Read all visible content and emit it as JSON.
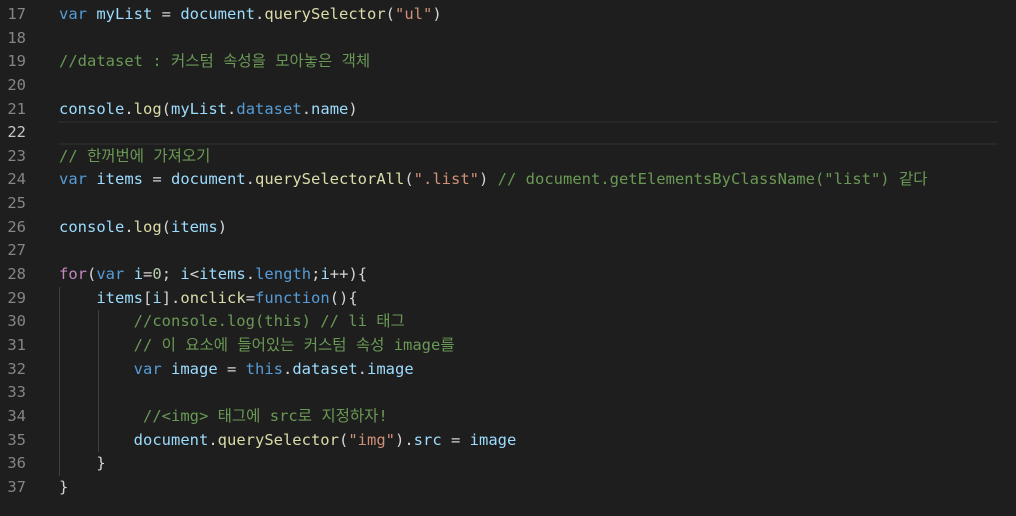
{
  "editor": {
    "theme": {
      "background": "#1e1e1e",
      "keyword": "#569cd6",
      "control": "#c586c0",
      "variable": "#9cdcfe",
      "function": "#dcdcaa",
      "string": "#ce9178",
      "number": "#b5cea8",
      "comment": "#6a9955",
      "plain": "#d4d4d4",
      "line_number": "#858585"
    },
    "current_line": 22,
    "lines": [
      {
        "n": "17",
        "indent": 0,
        "tokens": [
          {
            "t": "kw",
            "v": "var"
          },
          {
            "t": "p",
            "v": " "
          },
          {
            "t": "var",
            "v": "myList"
          },
          {
            "t": "p",
            "v": " = "
          },
          {
            "t": "var",
            "v": "document"
          },
          {
            "t": "p",
            "v": "."
          },
          {
            "t": "fn",
            "v": "querySelector"
          },
          {
            "t": "p",
            "v": "("
          },
          {
            "t": "str",
            "v": "\"ul\""
          },
          {
            "t": "p",
            "v": ")"
          }
        ]
      },
      {
        "n": "18",
        "indent": 0,
        "tokens": []
      },
      {
        "n": "19",
        "indent": 0,
        "tokens": [
          {
            "t": "cm",
            "v": "//dataset : 커스텀 속성을 모아놓은 객체"
          }
        ]
      },
      {
        "n": "20",
        "indent": 0,
        "tokens": []
      },
      {
        "n": "21",
        "indent": 0,
        "tokens": [
          {
            "t": "var",
            "v": "console"
          },
          {
            "t": "p",
            "v": "."
          },
          {
            "t": "fn",
            "v": "log"
          },
          {
            "t": "p",
            "v": "("
          },
          {
            "t": "var",
            "v": "myList"
          },
          {
            "t": "p",
            "v": "."
          },
          {
            "t": "kw",
            "v": "dataset"
          },
          {
            "t": "p",
            "v": "."
          },
          {
            "t": "var",
            "v": "name"
          },
          {
            "t": "p",
            "v": ")"
          }
        ]
      },
      {
        "n": "22",
        "indent": 0,
        "tokens": []
      },
      {
        "n": "23",
        "indent": 0,
        "tokens": [
          {
            "t": "cm",
            "v": "// 한꺼번에 가져오기"
          }
        ]
      },
      {
        "n": "24",
        "indent": 0,
        "tokens": [
          {
            "t": "kw",
            "v": "var"
          },
          {
            "t": "p",
            "v": " "
          },
          {
            "t": "var",
            "v": "items"
          },
          {
            "t": "p",
            "v": " = "
          },
          {
            "t": "var",
            "v": "document"
          },
          {
            "t": "p",
            "v": "."
          },
          {
            "t": "fn",
            "v": "querySelectorAll"
          },
          {
            "t": "p",
            "v": "("
          },
          {
            "t": "str",
            "v": "\".list\""
          },
          {
            "t": "p",
            "v": ") "
          },
          {
            "t": "cm",
            "v": "// document.getElementsByClassName(\"list\") 같다"
          }
        ]
      },
      {
        "n": "25",
        "indent": 0,
        "tokens": []
      },
      {
        "n": "26",
        "indent": 0,
        "tokens": [
          {
            "t": "var",
            "v": "console"
          },
          {
            "t": "p",
            "v": "."
          },
          {
            "t": "fn",
            "v": "log"
          },
          {
            "t": "p",
            "v": "("
          },
          {
            "t": "var",
            "v": "items"
          },
          {
            "t": "p",
            "v": ")"
          }
        ]
      },
      {
        "n": "27",
        "indent": 0,
        "tokens": []
      },
      {
        "n": "28",
        "indent": 0,
        "tokens": [
          {
            "t": "ctrl",
            "v": "for"
          },
          {
            "t": "p",
            "v": "("
          },
          {
            "t": "kw",
            "v": "var"
          },
          {
            "t": "p",
            "v": " "
          },
          {
            "t": "var",
            "v": "i"
          },
          {
            "t": "p",
            "v": "="
          },
          {
            "t": "num",
            "v": "0"
          },
          {
            "t": "p",
            "v": "; "
          },
          {
            "t": "var",
            "v": "i"
          },
          {
            "t": "p",
            "v": "<"
          },
          {
            "t": "var",
            "v": "items"
          },
          {
            "t": "p",
            "v": "."
          },
          {
            "t": "kw",
            "v": "length"
          },
          {
            "t": "p",
            "v": ";"
          },
          {
            "t": "var",
            "v": "i"
          },
          {
            "t": "p",
            "v": "++){"
          }
        ]
      },
      {
        "n": "29",
        "indent": 1,
        "tokens": [
          {
            "t": "p",
            "v": "    "
          },
          {
            "t": "var",
            "v": "items"
          },
          {
            "t": "p",
            "v": "["
          },
          {
            "t": "var",
            "v": "i"
          },
          {
            "t": "p",
            "v": "]."
          },
          {
            "t": "fn",
            "v": "onclick"
          },
          {
            "t": "p",
            "v": "="
          },
          {
            "t": "kw",
            "v": "function"
          },
          {
            "t": "p",
            "v": "(){"
          }
        ]
      },
      {
        "n": "30",
        "indent": 2,
        "tokens": [
          {
            "t": "p",
            "v": "        "
          },
          {
            "t": "cm",
            "v": "//console.log(this) // li 태그"
          }
        ]
      },
      {
        "n": "31",
        "indent": 2,
        "tokens": [
          {
            "t": "p",
            "v": "        "
          },
          {
            "t": "cm",
            "v": "// 이 요소에 들어있는 커스텀 속성 image를"
          }
        ]
      },
      {
        "n": "32",
        "indent": 2,
        "tokens": [
          {
            "t": "p",
            "v": "        "
          },
          {
            "t": "kw",
            "v": "var"
          },
          {
            "t": "p",
            "v": " "
          },
          {
            "t": "var",
            "v": "image"
          },
          {
            "t": "p",
            "v": " = "
          },
          {
            "t": "kw",
            "v": "this"
          },
          {
            "t": "p",
            "v": "."
          },
          {
            "t": "var",
            "v": "dataset"
          },
          {
            "t": "p",
            "v": "."
          },
          {
            "t": "var",
            "v": "image"
          }
        ]
      },
      {
        "n": "33",
        "indent": 2,
        "tokens": []
      },
      {
        "n": "34",
        "indent": 2,
        "tokens": [
          {
            "t": "p",
            "v": "         "
          },
          {
            "t": "cm",
            "v": "//<img> 태그에 src로 지정하자!"
          }
        ]
      },
      {
        "n": "35",
        "indent": 2,
        "tokens": [
          {
            "t": "p",
            "v": "        "
          },
          {
            "t": "var",
            "v": "document"
          },
          {
            "t": "p",
            "v": "."
          },
          {
            "t": "fn",
            "v": "querySelector"
          },
          {
            "t": "p",
            "v": "("
          },
          {
            "t": "str",
            "v": "\"img\""
          },
          {
            "t": "p",
            "v": ")."
          },
          {
            "t": "var",
            "v": "src"
          },
          {
            "t": "p",
            "v": " = "
          },
          {
            "t": "var",
            "v": "image"
          }
        ]
      },
      {
        "n": "36",
        "indent": 1,
        "tokens": [
          {
            "t": "p",
            "v": "    }"
          }
        ]
      },
      {
        "n": "37",
        "indent": 0,
        "tokens": [
          {
            "t": "p",
            "v": "}"
          }
        ]
      }
    ]
  }
}
